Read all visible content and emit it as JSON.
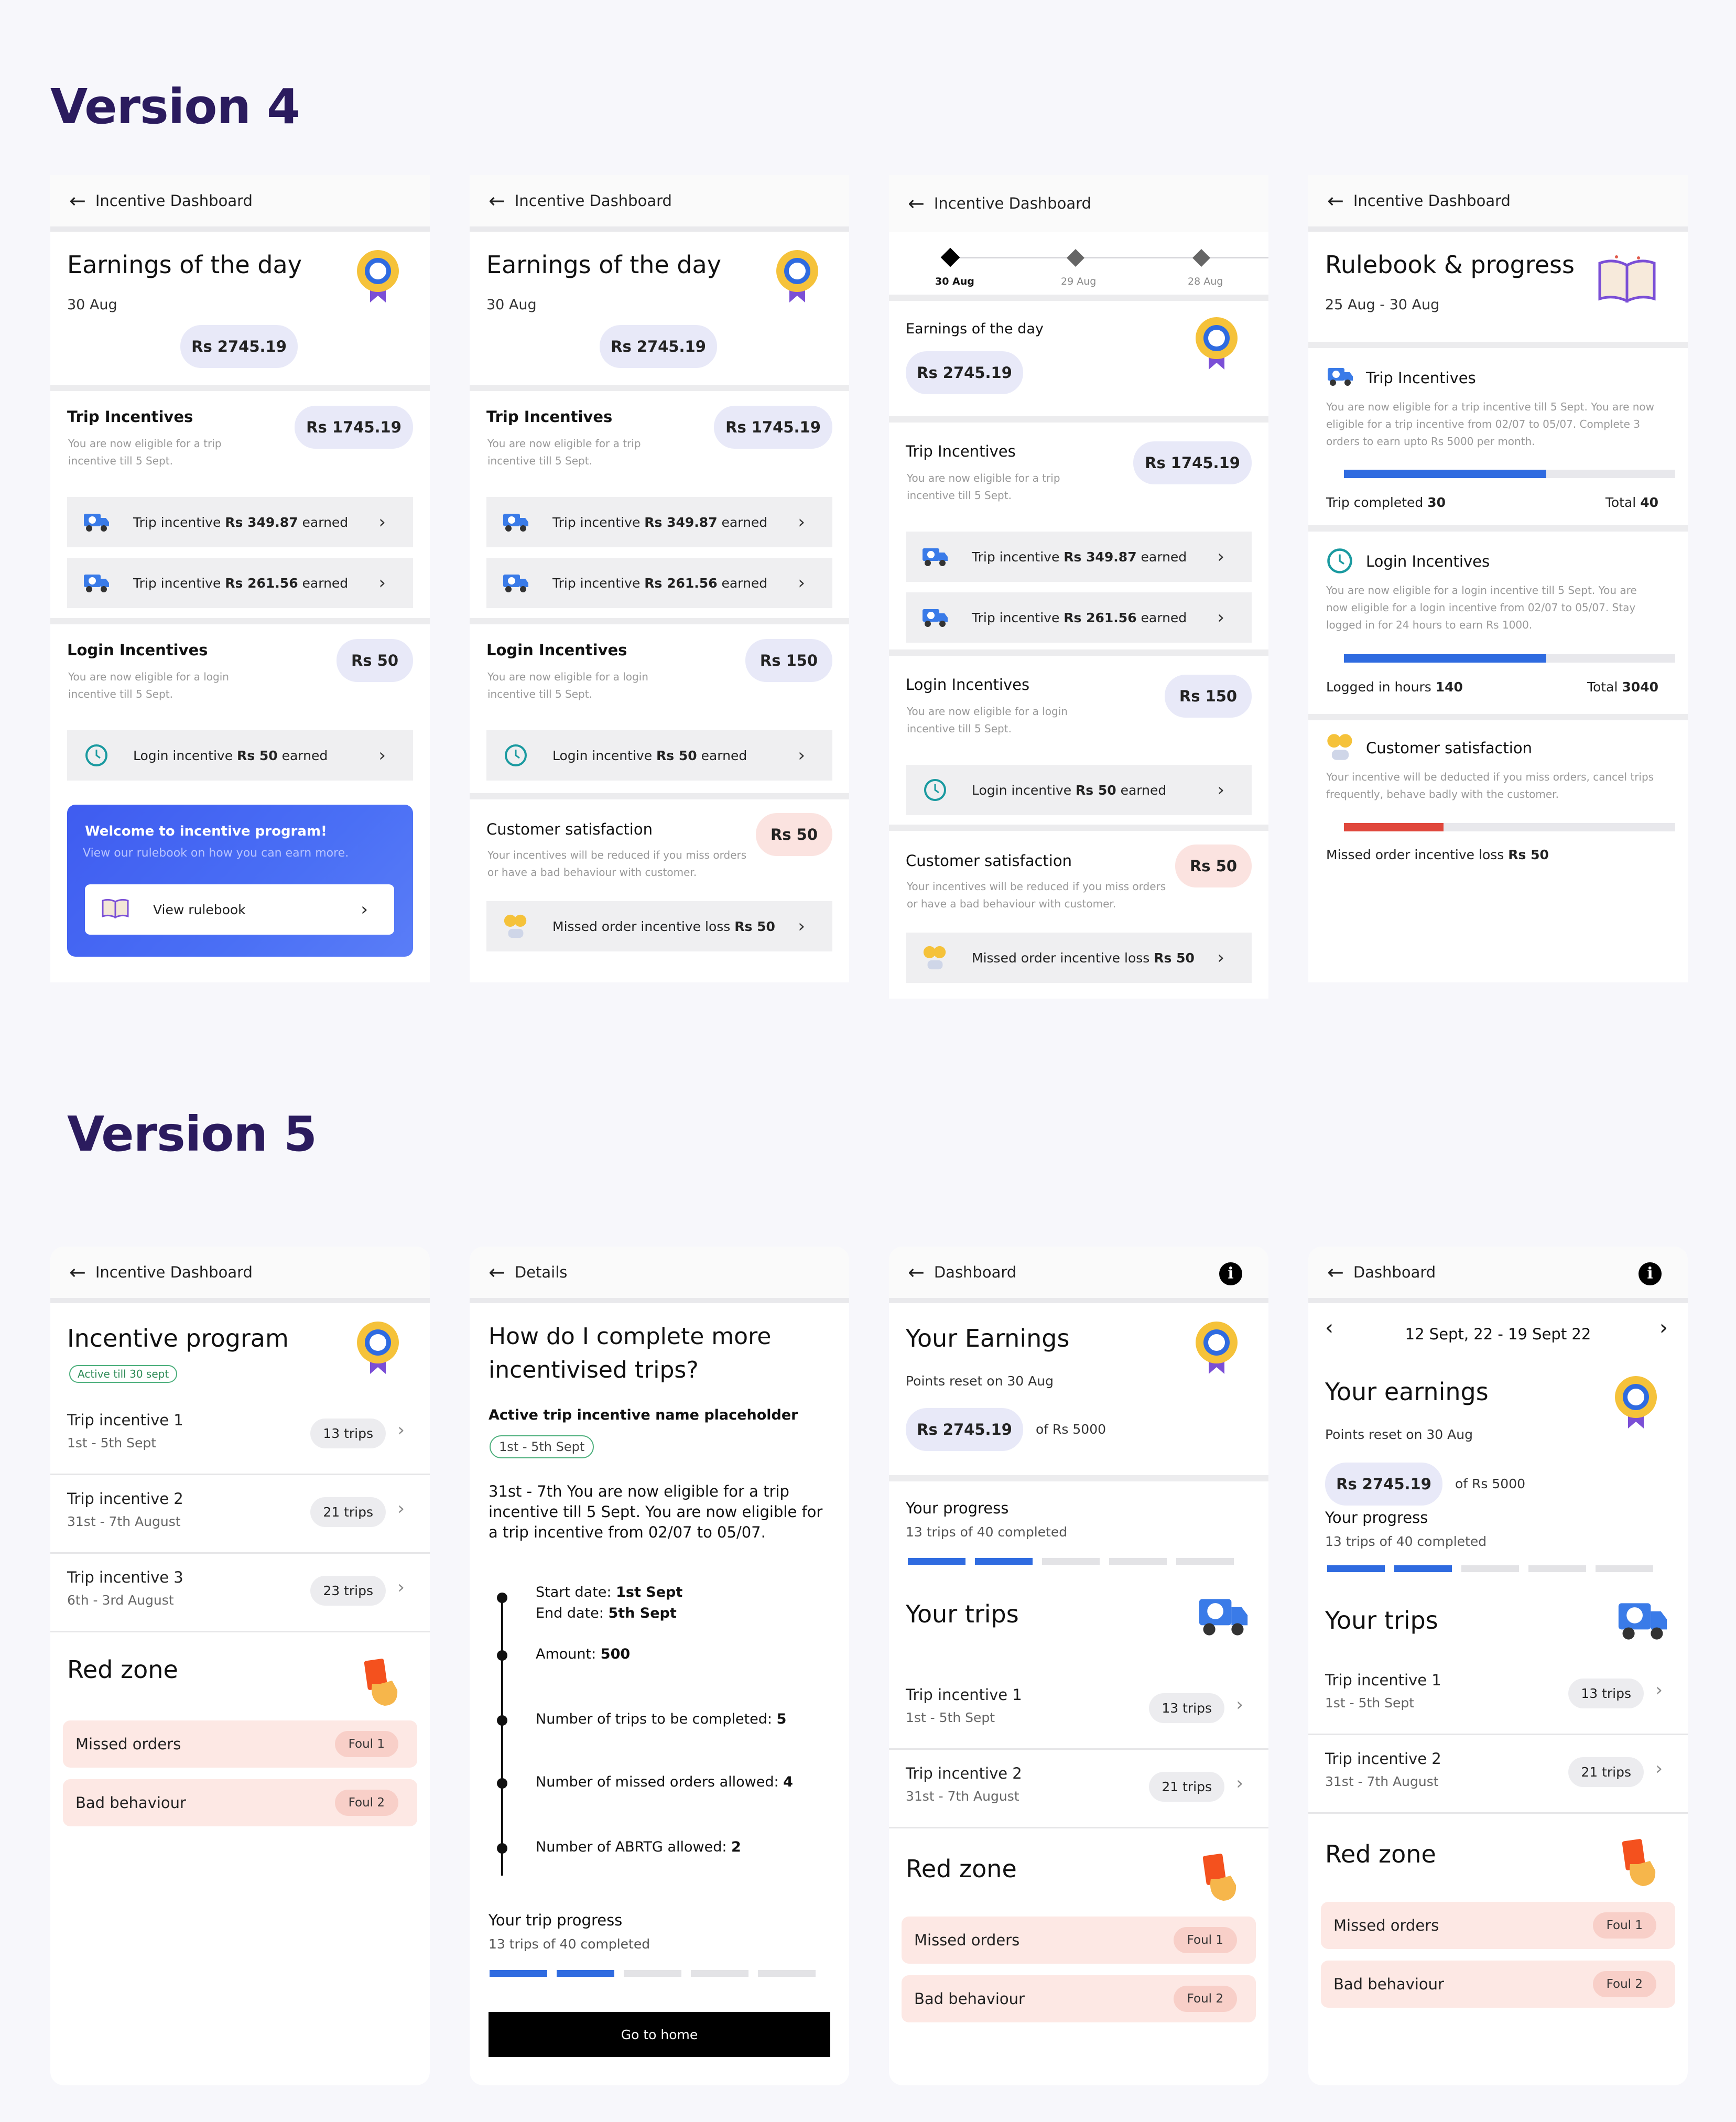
{
  "titles": {
    "v4": "Version 4",
    "v5": "Version 5"
  },
  "common": {
    "dash": "Incentive Dashboard",
    "trip_inc": "Trip Incentives",
    "login_inc": "Login Incentives",
    "cust_sat": "Customer satisfaction",
    "trip_elig": "You are now eligible for a trip incentive till 5 Sept.",
    "login_elig": "You are now eligible for a login incentive till 5 Sept.",
    "cust_desc": "Your incentives will be reduced if you miss orders or have a bad behaviour with customer.",
    "tp": "Trip incentive",
    "tr1": "Rs 349.87",
    "tr2": "Rs 261.56",
    "earned": "earned",
    "lp": "Login incentive",
    "lr": "Rs 50",
    "missed_p": "Missed order incentive loss",
    "missed_v": "Rs 50",
    "earn_day": "Earnings of the day",
    "date": "30 Aug",
    "amount": "Rs 2745.19",
    "trip_amt": "Rs 1745.19"
  },
  "s1": {
    "login_amt": "Rs 50",
    "welcome": "Welcome to incentive program!",
    "welcome_sub": "View our rulebook on how you can earn more.",
    "rulebook": "View rulebook"
  },
  "s2": {
    "login_amt": "Rs 150",
    "cust_amt": "Rs 50"
  },
  "s3": {
    "dates": [
      "30 Aug",
      "29 Aug",
      "28 Aug"
    ],
    "login_amt": "Rs 150",
    "cust_amt": "Rs 50"
  },
  "s4": {
    "title": "Rulebook & progress",
    "range": "25 Aug - 30 Aug",
    "trip_desc": "You are now eligible for a trip incentive till 5 Sept. You are now eligible for a trip incentive from 02/07 to 05/07. Complete 3 orders to earn upto Rs 5000 per month.",
    "trip_done_l": "Trip completed",
    "trip_done": "30",
    "total_l": "Total",
    "trip_total": "40",
    "trip_frac": 0.61,
    "login_desc": "You are now eligible for a login incentive till 5 Sept. You are now eligible for a login incentive from 02/07 to 05/07. Stay logged in for 24 hours to earn Rs 1000.",
    "hours_l": "Logged in hours",
    "hours": "140",
    "hours_total": "3040",
    "login_frac": 0.61,
    "cust_desc": "Your incentive will be deducted if you miss orders, cancel trips frequently, behave badly with the customer.",
    "missed_l": "Missed order incentive loss",
    "missed_v": "Rs 50",
    "cust_frac": 0.3
  },
  "v5": {
    "prog_title": "Incentive program",
    "active": "Active till 30 sept",
    "trips": [
      {
        "t": "Trip incentive 1",
        "d": "1st - 5th Sept",
        "n": "13 trips"
      },
      {
        "t": "Trip incentive 2",
        "d": "31st - 7th August",
        "n": "21 trips"
      },
      {
        "t": "Trip incentive 3",
        "d": "6th - 3rd August",
        "n": "23 trips"
      }
    ],
    "red": "Red zone",
    "missed": "Missed orders",
    "bad": "Bad behaviour",
    "foul1": "Foul 1",
    "foul2": "Foul 2",
    "details": "Details",
    "q": "How do I complete more incentivised trips?",
    "name": "Active trip incentive name placeholder",
    "range": "1st - 5th Sept",
    "desc": "31st - 7th You are now eligible for a trip incentive till 5 Sept. You are now eligible for a trip incentive from 02/07 to 05/07.",
    "start_l": "Start date:",
    "start": "1st Sept",
    "end_l": "End date:",
    "end": "5th Sept",
    "amt_l": "Amount:",
    "amt": "500",
    "ntrips_l": "Number of trips  to be completed:",
    "ntrips": "5",
    "nmiss_l": "Number of missed orders allowed:",
    "nmiss": "4",
    "nabrtg_l": "Number of ABRTG allowed:",
    "nabrtg": "2",
    "tprog": "Your trip progress",
    "tprog_sub": "13 trips of 40 completed",
    "home": "Go to home",
    "dash": "Dashboard",
    "your_earn": "Your Earnings",
    "your_earn2": "Your earnings",
    "reset": "Points reset on 30 Aug",
    "of": "of Rs 5000",
    "yprog": "Your progress",
    "yprog_sub": "13 trips of 40 completed",
    "your_trips": "Your trips",
    "week": "12 Sept, 22 - 19 Sept 22",
    "info": "i"
  }
}
